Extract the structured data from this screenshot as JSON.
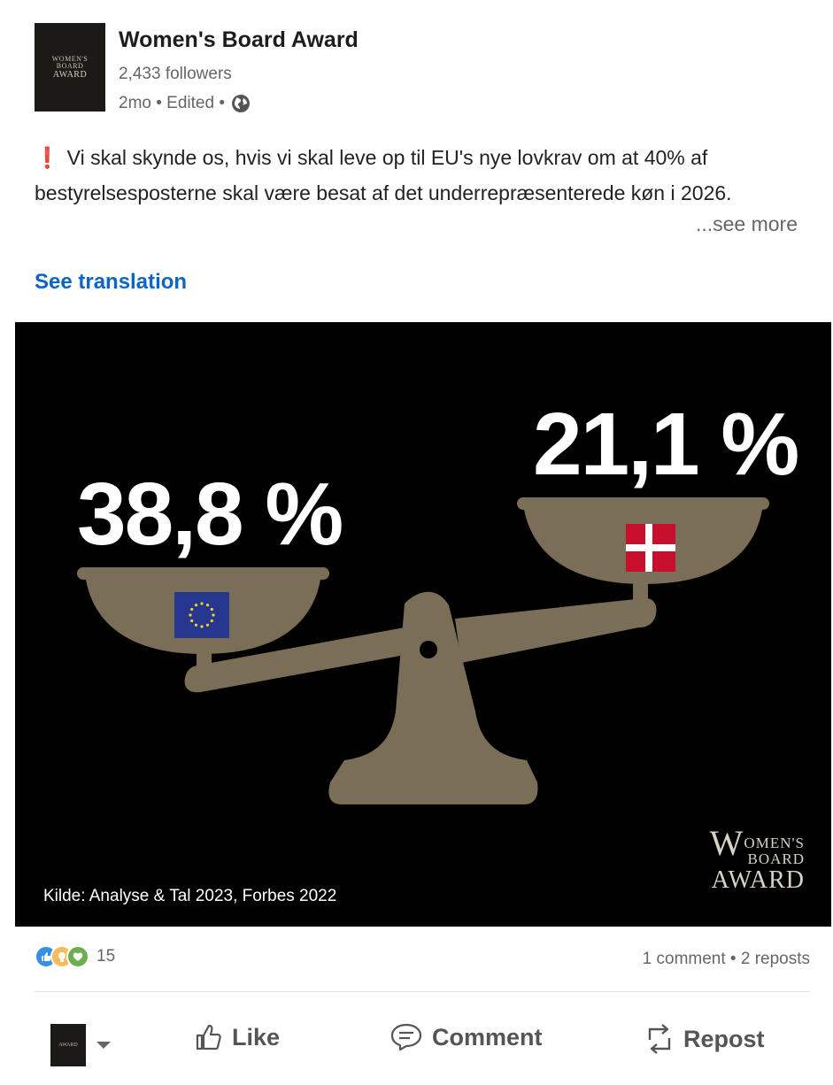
{
  "author": {
    "name": "Women's Board Award",
    "followers": "2,433 followers",
    "meta": "2mo • Edited •",
    "logo": {
      "small": [
        "WOMEN'S",
        "BOARD"
      ],
      "big": "AWARD"
    }
  },
  "post": {
    "alert": "❗",
    "text": "Vi skal skynde os, hvis vi skal leve op til EU's nye lovkrav om at 40% af bestyrelsesposterne skal være besat af det underrepræsenterede køn i 2026.",
    "see_more": "...see more",
    "see_translation": "See translation"
  },
  "image": {
    "eu_percent": "38,8 %",
    "dk_percent": "21,1 %",
    "source": "Kilde: Analyse & Tal 2023, Forbes 2022",
    "watermark": {
      "line1": "OMEN'S",
      "line2": "BOARD",
      "big": "WARD",
      "initial1": "W",
      "initial2": "A"
    },
    "colors": {
      "background": "#000000",
      "scale": "#7a6e57",
      "eu_blue": "#27378f",
      "eu_stars": "#f3d42a",
      "dk_red": "#c8102e"
    }
  },
  "social": {
    "reaction_count": "15",
    "comments_reposts": "1 comment • 2 reposts",
    "reactions": [
      "like-icon",
      "idea-icon",
      "support-icon"
    ]
  },
  "actions": {
    "like": "Like",
    "comment": "Comment",
    "repost": "Repost"
  },
  "colors": {
    "link": "#0a66c2",
    "muted": "#666666",
    "alert": "#d11124"
  }
}
